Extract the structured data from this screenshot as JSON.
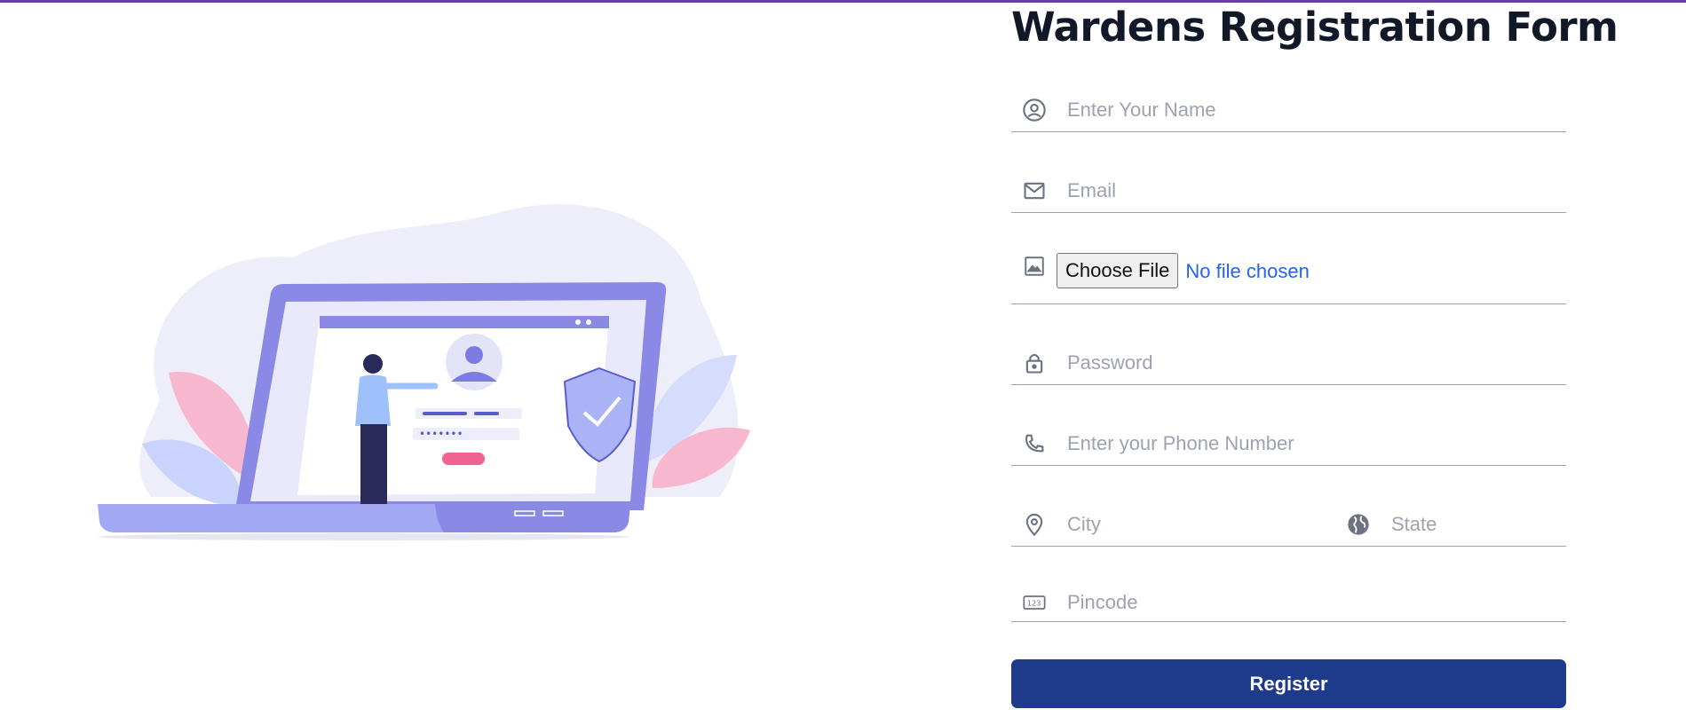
{
  "form": {
    "title": "Wardens Registration Form",
    "name_placeholder": "Enter Your Name",
    "email_placeholder": "Email",
    "file_button_label": "Choose File",
    "file_status": "No file chosen",
    "password_placeholder": "Password",
    "phone_placeholder": "Enter your Phone Number",
    "city_placeholder": "City",
    "state_placeholder": "State",
    "pincode_placeholder": "Pincode",
    "register_label": "Register"
  },
  "colors": {
    "accent_top_border": "#6b3fa0",
    "register_button": "#1e3a8a",
    "file_status_text": "#2563eb",
    "illustration_primary": "#7c7ce0"
  },
  "icons": {
    "name": "user-circle-icon",
    "email": "envelope-icon",
    "file": "image-icon",
    "password": "lock-icon",
    "phone": "phone-icon",
    "city": "location-pin-icon",
    "state": "globe-icon",
    "pincode": "numbers-123-icon"
  }
}
